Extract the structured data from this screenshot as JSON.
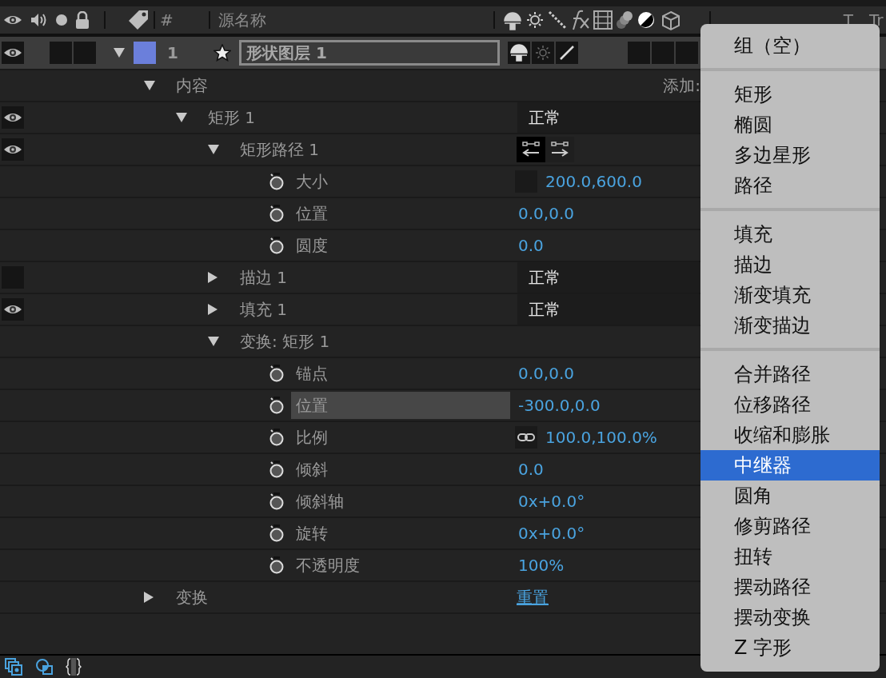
{
  "header": {
    "hash": "#",
    "source_name": "源名称",
    "col_t": "T",
    "col_tr": "Tr"
  },
  "layer": {
    "visible": true,
    "expanded": true,
    "color": "#6b7fdb",
    "number": "1",
    "name": "形状图层 1",
    "switches": [
      {
        "kind": "shy",
        "on": true
      },
      {
        "kind": "quality",
        "on": false
      },
      {
        "kind": "draft",
        "on": true
      }
    ],
    "flags": [
      {
        "on": false
      },
      {
        "on": false
      },
      {
        "on": false
      }
    ]
  },
  "rows": [
    {
      "kind": "group",
      "label": "内容",
      "expanded": true,
      "selected": false,
      "value": {
        "kind": "add",
        "text": "添加:"
      },
      "children": [
        {
          "kind": "group",
          "label": "矩形 1",
          "expanded": true,
          "selected": false,
          "visible": true,
          "value": {
            "kind": "mode",
            "text": "正常"
          },
          "children": [
            {
              "kind": "group",
              "label": "矩形路径 1",
              "expanded": true,
              "selected": false,
              "visible": true,
              "value": {
                "kind": "direction",
                "options": [
                  {
                    "selected": true
                  },
                  {
                    "selected": false
                  }
                ]
              },
              "children": [
                {
                  "kind": "prop",
                  "label": "大小",
                  "selected": false,
                  "value": {
                    "kind": "number",
                    "constrain": false,
                    "text": "200.0,600.0"
                  }
                },
                {
                  "kind": "prop",
                  "label": "位置",
                  "selected": false,
                  "value": {
                    "kind": "number",
                    "text": "0.0,0.0"
                  }
                },
                {
                  "kind": "prop",
                  "label": "圆度",
                  "selected": false,
                  "value": {
                    "kind": "number",
                    "text": "0.0"
                  }
                }
              ]
            },
            {
              "kind": "group",
              "label": "描边 1",
              "expanded": false,
              "selected": false,
              "visible": false,
              "value": {
                "kind": "mode",
                "text": "正常"
              }
            },
            {
              "kind": "group",
              "label": "填充 1",
              "expanded": false,
              "selected": false,
              "visible": true,
              "value": {
                "kind": "mode",
                "text": "正常"
              }
            },
            {
              "kind": "group",
              "label": "变换: 矩形 1",
              "expanded": true,
              "selected": false,
              "children": [
                {
                  "kind": "prop",
                  "label": "锚点",
                  "selected": false,
                  "value": {
                    "kind": "number",
                    "text": "0.0,0.0"
                  }
                },
                {
                  "kind": "prop",
                  "label": "位置",
                  "selected": true,
                  "value": {
                    "kind": "number",
                    "text": "-300.0,0.0"
                  }
                },
                {
                  "kind": "prop",
                  "label": "比例",
                  "selected": false,
                  "value": {
                    "kind": "number",
                    "constrain": true,
                    "text": "100.0,100.0%"
                  }
                },
                {
                  "kind": "prop",
                  "label": "倾斜",
                  "selected": false,
                  "value": {
                    "kind": "number",
                    "text": "0.0"
                  }
                },
                {
                  "kind": "prop",
                  "label": "倾斜轴",
                  "selected": false,
                  "value": {
                    "kind": "number",
                    "text": "0x+0.0°"
                  }
                },
                {
                  "kind": "prop",
                  "label": "旋转",
                  "selected": false,
                  "value": {
                    "kind": "number",
                    "text": "0x+0.0°"
                  }
                },
                {
                  "kind": "prop",
                  "label": "不透明度",
                  "selected": false,
                  "value": {
                    "kind": "number",
                    "text": "100%"
                  }
                }
              ]
            }
          ]
        }
      ]
    },
    {
      "kind": "group",
      "label": "变换",
      "expanded": false,
      "selected": false,
      "value": {
        "kind": "link",
        "text": "重置"
      }
    }
  ],
  "menu": {
    "groups": [
      [
        {
          "label": "组（空）",
          "selected": false
        }
      ],
      [
        {
          "label": "矩形",
          "selected": false
        },
        {
          "label": "椭圆",
          "selected": false
        },
        {
          "label": "多边星形",
          "selected": false
        },
        {
          "label": "路径",
          "selected": false
        }
      ],
      [
        {
          "label": "填充",
          "selected": false
        },
        {
          "label": "描边",
          "selected": false
        },
        {
          "label": "渐变填充",
          "selected": false
        },
        {
          "label": "渐变描边",
          "selected": false
        }
      ],
      [
        {
          "label": "合并路径",
          "selected": false
        },
        {
          "label": "位移路径",
          "selected": false
        },
        {
          "label": "收缩和膨胀",
          "selected": false
        },
        {
          "label": "中继器",
          "selected": true
        },
        {
          "label": "圆角",
          "selected": false
        },
        {
          "label": "修剪路径",
          "selected": false
        },
        {
          "label": "扭转",
          "selected": false
        },
        {
          "label": "摆动路径",
          "selected": false
        },
        {
          "label": "摆动变换",
          "selected": false
        },
        {
          "label": "Z 字形",
          "selected": false
        }
      ]
    ]
  }
}
